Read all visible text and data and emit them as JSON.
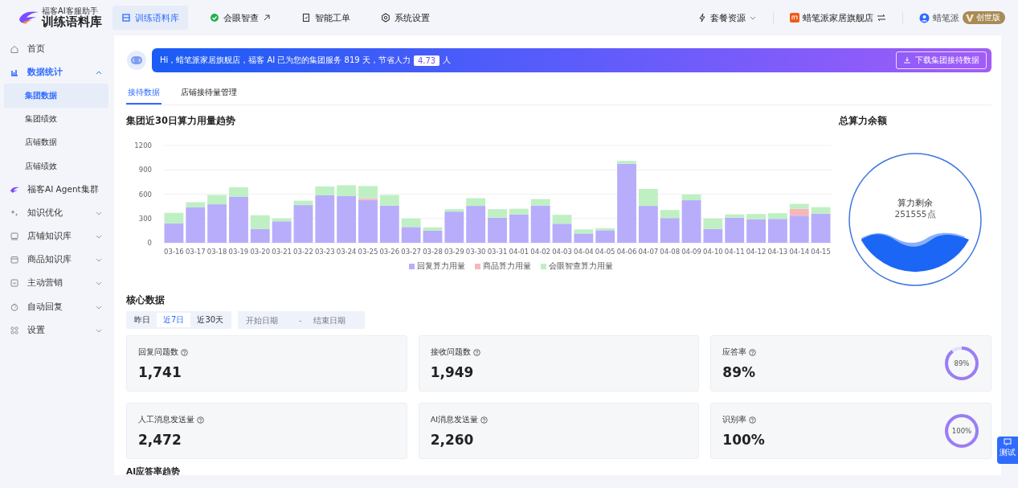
{
  "app": {
    "subtitle": "福客AI客服助手",
    "title": "训练语料库"
  },
  "top_nav": [
    {
      "label": "训练语料库",
      "selected": true,
      "kind": "list",
      "external": false
    },
    {
      "label": "会眼智查",
      "selected": false,
      "kind": "check",
      "external": true
    },
    {
      "label": "智能工单",
      "selected": false,
      "kind": "ticket",
      "external": false
    },
    {
      "label": "系统设置",
      "selected": false,
      "kind": "gear",
      "external": false
    }
  ],
  "top_right": {
    "plan": "套餐资源",
    "store": "蜡笔派家居旗舰店",
    "user": "蜡笔派",
    "edition": "创世版"
  },
  "sidebar": {
    "items": [
      {
        "label": "首页",
        "kind": "home"
      },
      {
        "label": "数据统计",
        "kind": "chart",
        "expanded": true,
        "children": [
          {
            "label": "集团数据",
            "selected": true
          },
          {
            "label": "集团绩效",
            "selected": false
          },
          {
            "label": "店铺数据",
            "selected": false
          },
          {
            "label": "店铺绩效",
            "selected": false
          }
        ]
      },
      {
        "label": "福客AI Agent集群",
        "kind": "logo"
      },
      {
        "label": "知识优化",
        "kind": "spark",
        "expanded": false
      },
      {
        "label": "店铺知识库",
        "kind": "book",
        "expanded": false
      },
      {
        "label": "商品知识库",
        "kind": "box",
        "expanded": false
      },
      {
        "label": "主动营销",
        "kind": "message",
        "expanded": false
      },
      {
        "label": "自动回复",
        "kind": "timer",
        "expanded": false
      },
      {
        "label": "设置",
        "kind": "grid",
        "expanded": false
      }
    ]
  },
  "banner": {
    "text": "Hi，蜡笔派家居旗舰店，福客 AI 已为您的集团服务 819 天，节省人力",
    "badge": "4.73",
    "unit": "人",
    "button": "下载集团接待数据"
  },
  "tabs": [
    {
      "label": "接待数据",
      "selected": true
    },
    {
      "label": "店铺接待量管理",
      "selected": false
    }
  ],
  "usage_chart": {
    "title": "集团近30日算力用量趋势",
    "chart_data": {
      "type": "bar",
      "stacked": true,
      "categories": [
        "03-16",
        "03-17",
        "03-18",
        "03-19",
        "03-20",
        "03-21",
        "03-22",
        "03-23",
        "03-24",
        "03-25",
        "03-26",
        "03-27",
        "03-28",
        "03-29",
        "03-30",
        "03-31",
        "04-01",
        "04-02",
        "04-03",
        "04-04",
        "04-05",
        "04-06",
        "04-07",
        "04-08",
        "04-09",
        "04-10",
        "04-11",
        "04-12",
        "04-13",
        "04-14",
        "04-15"
      ],
      "grid": true,
      "ylim": [
        0,
        1200
      ],
      "yticks": [
        0,
        300,
        600,
        900,
        1200
      ],
      "series": [
        {
          "name": "回复算力用量",
          "color": "#b7adfb",
          "values": [
            240,
            440,
            475,
            570,
            170,
            265,
            465,
            585,
            575,
            530,
            460,
            195,
            150,
            385,
            455,
            310,
            350,
            460,
            235,
            115,
            155,
            975,
            455,
            305,
            525,
            170,
            310,
            290,
            295,
            335,
            360
          ]
        },
        {
          "name": "商品算力用量",
          "color": "#f7b7b9",
          "values": [
            0,
            0,
            0,
            0,
            0,
            0,
            0,
            0,
            null,
            20,
            0,
            0,
            0,
            0,
            0,
            0,
            0,
            0,
            0,
            0,
            0,
            0,
            0,
            0,
            0,
            0,
            0,
            0,
            0,
            85,
            0
          ]
        },
        {
          "name": "会眼智查算力用量",
          "color": "#bff0c3",
          "values": [
            130,
            60,
            115,
            115,
            170,
            35,
            55,
            110,
            135,
            150,
            130,
            105,
            40,
            30,
            95,
            105,
            70,
            80,
            110,
            50,
            25,
            35,
            210,
            100,
            70,
            130,
            40,
            65,
            70,
            60,
            80
          ]
        }
      ]
    }
  },
  "balance": {
    "title": "总算力余额",
    "label": "算力剩余",
    "value": "251555点"
  },
  "core": {
    "title": "核心数据",
    "ranges": [
      {
        "label": "昨日",
        "selected": false
      },
      {
        "label": "近7日",
        "selected": true
      },
      {
        "label": "近30天",
        "selected": false
      }
    ],
    "date_start": {
      "placeholder": "开始日期"
    },
    "separator": "-",
    "date_end": {
      "placeholder": "结束日期"
    },
    "cards": [
      {
        "kind": "plain",
        "label": "回复问题数",
        "value": "1,741"
      },
      {
        "kind": "plain",
        "label": "接收问题数",
        "value": "1,949"
      },
      {
        "kind": "ring",
        "label": "应答率",
        "value": "89%",
        "level": 0.89,
        "ring_text": "89%"
      },
      {
        "kind": "plain",
        "label": "人工消息发送量",
        "value": "2,472"
      },
      {
        "kind": "plain",
        "label": "AI消息发送量",
        "value": "2,260"
      },
      {
        "kind": "ring",
        "label": "识别率",
        "value": "100%",
        "level": 1,
        "ring_text": "100%"
      }
    ]
  },
  "next_section": "AI应答率趋势",
  "float_button": "测试"
}
